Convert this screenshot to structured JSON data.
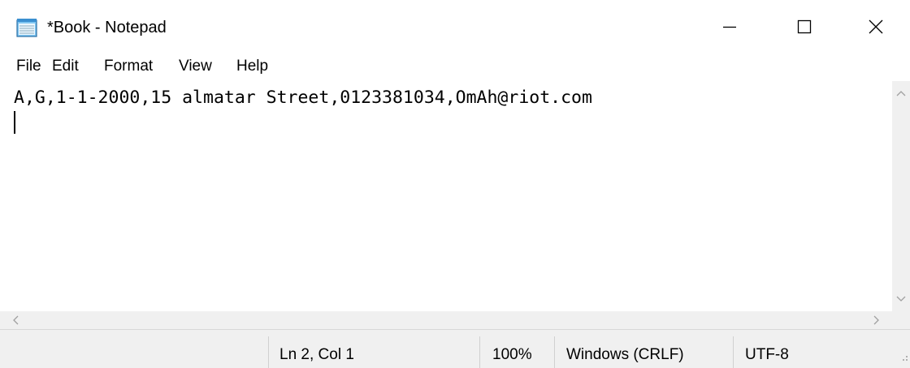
{
  "window": {
    "title": "*Book - Notepad",
    "app_icon": "notepad-icon",
    "controls": {
      "minimize_icon": "minimize-icon",
      "maximize_icon": "maximize-icon",
      "close_icon": "close-icon"
    }
  },
  "menu": {
    "items": [
      {
        "label": "File"
      },
      {
        "label": "Edit"
      },
      {
        "label": "Format"
      },
      {
        "label": "View"
      },
      {
        "label": "Help"
      }
    ]
  },
  "editor": {
    "lines": [
      "A,G,1-1-2000,15 almatar Street,0123381034,OmAh@riot.com",
      ""
    ]
  },
  "statusbar": {
    "position": "Ln 2, Col 1",
    "zoom": "100%",
    "line_endings": "Windows (CRLF)",
    "encoding": "UTF-8"
  },
  "colors": {
    "chrome_background": "#f0f0f0",
    "editor_background": "#ffffff",
    "text": "#000000",
    "scroll_arrow": "#a0a0a0"
  }
}
